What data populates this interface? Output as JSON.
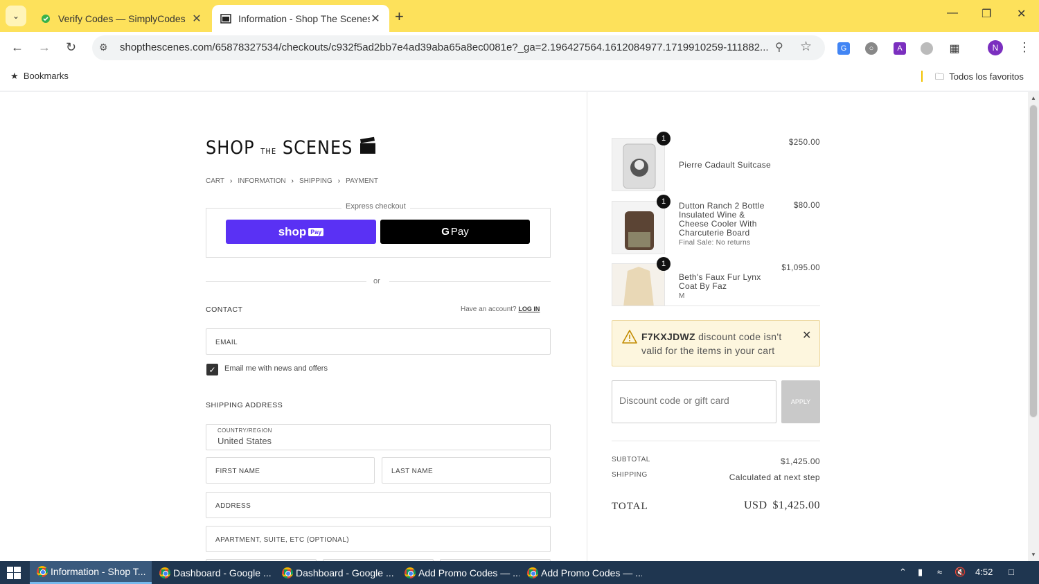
{
  "browser": {
    "tabs": [
      {
        "title": "Verify Codes — SimplyCodes",
        "active": false
      },
      {
        "title": "Information - Shop The Scenes",
        "active": true
      }
    ],
    "url": "shopthescenes.com/65878327534/checkouts/c932f5ad2bb7e4ad39aba65a8ec0081e?_ga=2.196427564.1612084977.1719910259-111882...",
    "bookmarks_label": "Bookmarks",
    "all_bookmarks_label": "Todos los favoritos",
    "profile_initial": "N"
  },
  "checkout": {
    "logo": {
      "shop": "SHOP",
      "the": "THE",
      "scenes": "SCENES"
    },
    "breadcrumb": [
      "CART",
      "INFORMATION",
      "SHIPPING",
      "PAYMENT"
    ],
    "express_label": "Express checkout",
    "shoppay_label": "shop",
    "shoppay_badge": "Pay",
    "gpay_label": "Pay",
    "or_label": "or",
    "contact_heading": "CONTACT",
    "have_account": "Have an account?",
    "login_label": "LOG IN",
    "email_placeholder": "EMAIL",
    "newsletter_label": "Email me with news and offers",
    "newsletter_checked": true,
    "shipping_heading": "SHIPPING ADDRESS",
    "country_label": "COUNTRY/REGION",
    "country_value": "United States",
    "first_name_placeholder": "FIRST NAME",
    "last_name_placeholder": "LAST NAME",
    "address_placeholder": "ADDRESS",
    "apartment_placeholder": "APARTMENT, SUITE, ETC (OPTIONAL)"
  },
  "order": {
    "items": [
      {
        "name": "Pierre Cadault Suitcase",
        "sub": "",
        "price": "$250.00",
        "qty": "1"
      },
      {
        "name": "Dutton Ranch 2 Bottle Insulated Wine & Cheese Cooler With Charcuterie Board",
        "sub": "Final Sale: No returns",
        "price": "$80.00",
        "qty": "1"
      },
      {
        "name": "Beth's Faux Fur Lynx Coat By Faz",
        "sub": "M",
        "price": "$1,095.00",
        "qty": "1"
      }
    ],
    "alert": {
      "code": "F7KXJDWZ",
      "message": "discount code isn't valid for the items in your cart"
    },
    "discount_placeholder": "Discount code or gift card",
    "apply_label": "APPLY",
    "subtotal_label": "SUBTOTAL",
    "subtotal_value": "$1,425.00",
    "shipping_label": "SHIPPING",
    "shipping_value": "Calculated at next step",
    "total_label": "TOTAL",
    "total_currency": "USD",
    "total_value": "$1,425.00"
  },
  "taskbar": {
    "items": [
      {
        "label": "Information - Shop T...",
        "active": true
      },
      {
        "label": "Dashboard - Google ...",
        "active": false
      },
      {
        "label": "Dashboard - Google ...",
        "active": false
      },
      {
        "label": "Add Promo Codes — ...",
        "active": false
      },
      {
        "label": "Add Promo Codes — ...",
        "active": false
      }
    ],
    "time": "4:52"
  },
  "colors": {
    "tabstrip": "#fde15b",
    "shoppay": "#5a31f4",
    "taskbar": "#1f3650",
    "alert_bg": "#fdf6de"
  }
}
